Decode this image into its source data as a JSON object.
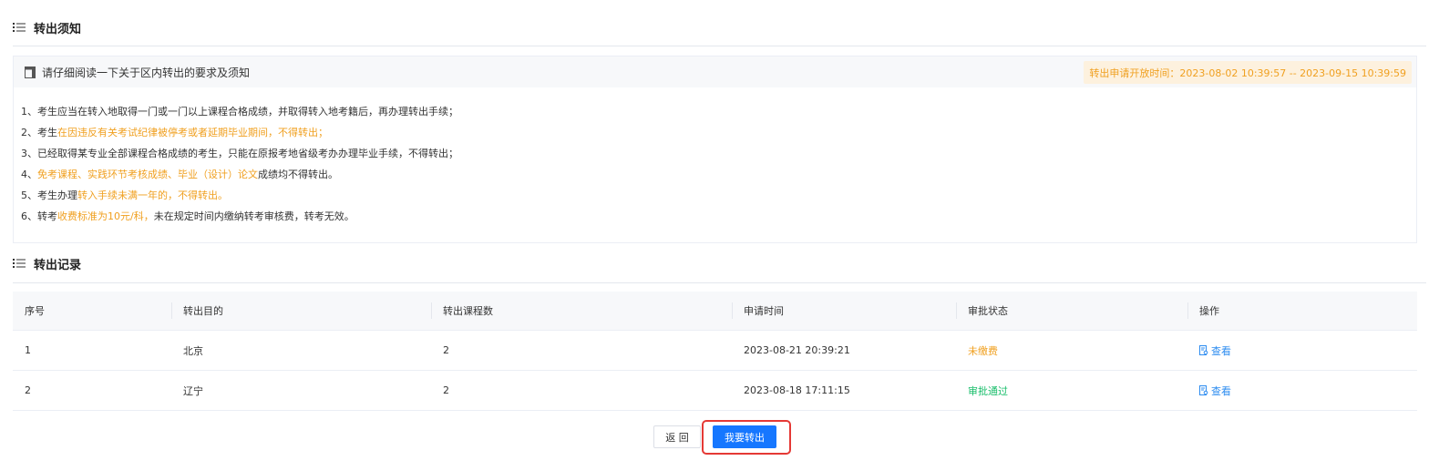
{
  "notice_section": {
    "title": "转出须知",
    "subtitle": "请仔细阅读一下关于区内转出的要求及须知",
    "open_time": "转出申请开放时间：2023-08-02 10:39:57 -- 2023-09-15 10:39:59",
    "rules": [
      [
        {
          "t": "1、考生应当在转入地取得一门或一门以上课程合格成绩，并取得转入地考籍后，再办理转出手续；",
          "hl": false
        }
      ],
      [
        {
          "t": "2、考生",
          "hl": false
        },
        {
          "t": "在因违反有关考试纪律被停考或者延期毕业期间，不得转出；",
          "hl": true
        }
      ],
      [
        {
          "t": "3、已经取得某专业全部课程合格成绩的考生，只能在原报考地省级考办办理毕业手续，不得转出；",
          "hl": false
        }
      ],
      [
        {
          "t": "4、",
          "hl": false
        },
        {
          "t": "免考课程、实践环节考核成绩、毕业（设计）论文",
          "hl": true
        },
        {
          "t": "成绩均不得转出。",
          "hl": false
        }
      ],
      [
        {
          "t": "5、考生办理",
          "hl": false
        },
        {
          "t": "转入手续未满一年的，不得转出。",
          "hl": true
        }
      ],
      [
        {
          "t": "6、转考",
          "hl": false
        },
        {
          "t": "收费标准为10元/科，",
          "hl": true
        },
        {
          "t": "未在规定时间内缴纳转考审核费，转考无效。",
          "hl": false
        }
      ]
    ]
  },
  "records_section": {
    "title": "转出记录",
    "columns": [
      "序号",
      "转出目的",
      "转出课程数",
      "申请时间",
      "审批状态",
      "操作"
    ],
    "rows": [
      {
        "no": "1",
        "destination": "北京",
        "course_count": "2",
        "applied_at": "2023-08-21 20:39:21",
        "status": "未缴费",
        "action": "查看"
      },
      {
        "no": "2",
        "destination": "辽宁",
        "course_count": "2",
        "applied_at": "2023-08-18 17:11:15",
        "status": "审批通过",
        "action": "查看"
      }
    ]
  },
  "buttons": {
    "back": "返 回",
    "transfer_out": "我要转出"
  },
  "colors": {
    "highlight": "#f0a020",
    "approved": "#19be6b",
    "link": "#2d8cf0",
    "primary": "#1677ff",
    "focus_ring": "#e53935"
  },
  "icons": {
    "section": "list-icon",
    "notice": "document-icon",
    "view": "view-document-icon"
  }
}
